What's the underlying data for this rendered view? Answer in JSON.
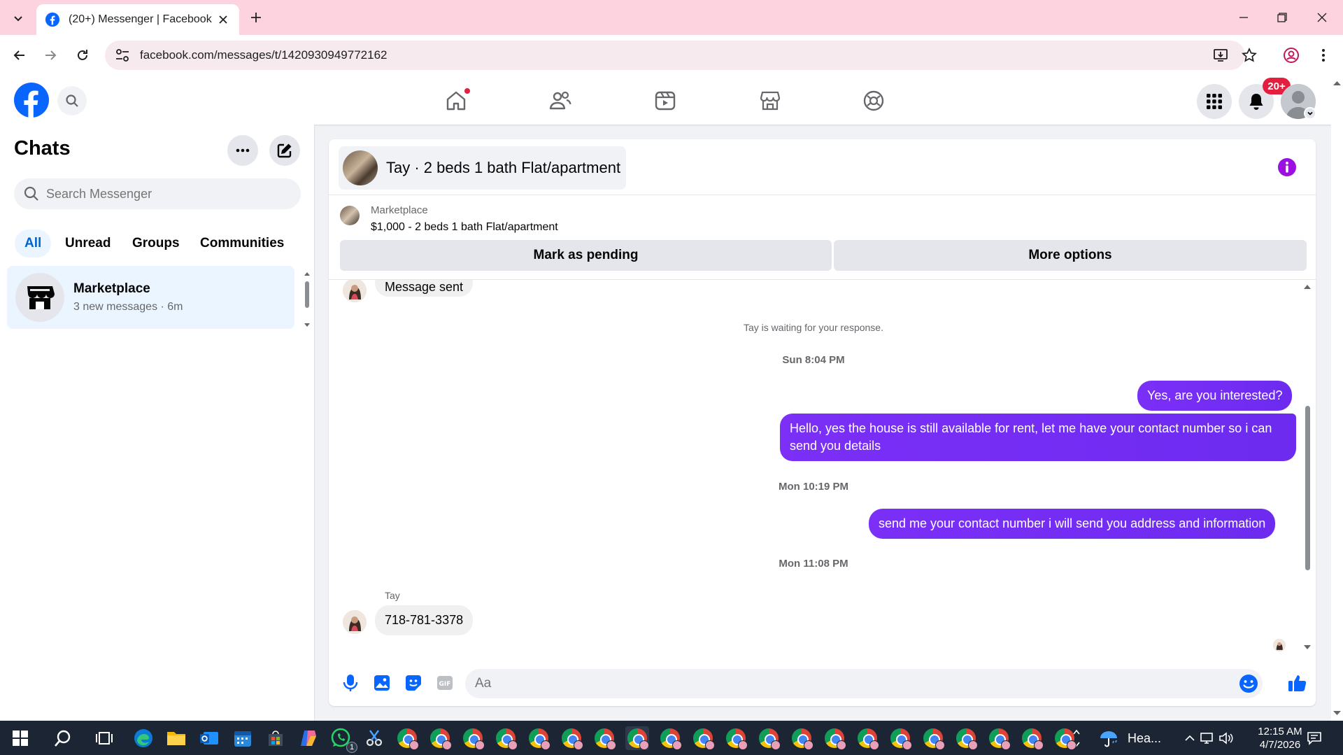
{
  "browser": {
    "tab_title": "(20+) Messenger | Facebook",
    "url": "facebook.com/messages/t/1420930949772162"
  },
  "header": {
    "notification_badge": "20+"
  },
  "sidebar": {
    "title": "Chats",
    "search_placeholder": "Search Messenger",
    "filters": [
      {
        "label": "All",
        "active": true
      },
      {
        "label": "Unread",
        "active": false
      },
      {
        "label": "Groups",
        "active": false
      },
      {
        "label": "Communities",
        "active": false
      }
    ],
    "chats": [
      {
        "name": "Marketplace",
        "subtitle": "3 new messages · 6m"
      }
    ]
  },
  "conversation": {
    "title": "Tay · 2 beds 1 bath Flat/apartment",
    "listing": {
      "label": "Marketplace",
      "price_title": "$1,000 - 2 beds 1 bath Flat/apartment",
      "mark_pending_label": "Mark as pending",
      "more_options_label": "More options"
    },
    "messages": {
      "partial_incoming": "Message sent",
      "waiting_notice": "Tay is waiting for your response.",
      "ts_1": "Sun 8:04 PM",
      "out_1": "Yes, are you interested?",
      "out_2": "Hello, yes the house is still available for rent, let me have your contact number so i can send you details",
      "ts_2": "Mon 10:19 PM",
      "out_3": "send me your contact number i will send you address and information",
      "ts_3": "Mon 11:08 PM",
      "sender_name": "Tay",
      "in_1": "718-781-3378"
    },
    "composer_placeholder": "Aa"
  },
  "taskbar": {
    "weather": "Hea...",
    "whatsapp_badge": "1",
    "time": "12:15 AM",
    "date": "4/7/2026"
  },
  "colors": {
    "tab_strip": "#fcd3de",
    "fb_blue": "#0866ff",
    "outgoing_bubble": "#7b2ff7",
    "badge_red": "#e41e3f",
    "info_purple": "#9b0fe0"
  }
}
